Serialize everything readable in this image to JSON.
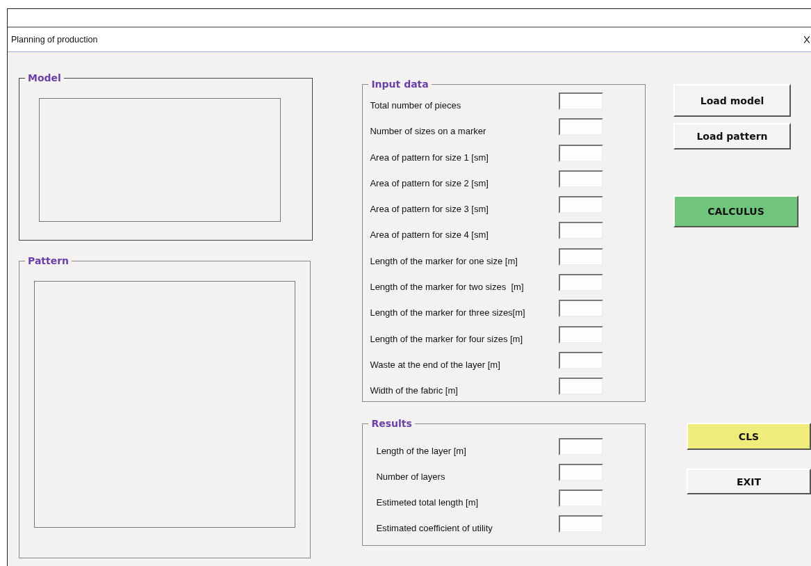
{
  "window": {
    "title": "Planning of production"
  },
  "model": {
    "legend": "Model"
  },
  "pattern": {
    "legend": "Pattern"
  },
  "input_data": {
    "legend": "Input data",
    "fields": [
      {
        "label": "Total number of pieces"
      },
      {
        "label": "Number of sizes on a marker"
      },
      {
        "label": "Area of pattern for size 1 [sm]"
      },
      {
        "label": "Area of pattern for size 2 [sm]"
      },
      {
        "label": "Area of pattern for size 3 [sm]"
      },
      {
        "label": "Area of pattern for size 4 [sm]"
      },
      {
        "label": "Length of the marker for one size [m]"
      },
      {
        "label": "Length of the marker for two sizes  [m]"
      },
      {
        "label": "Length of the marker for three sizes[m]"
      },
      {
        "label": "Length of the marker for four sizes [m]"
      },
      {
        "label": "Waste at the end of the layer [m]"
      },
      {
        "label": "Width of the fabric [m]"
      }
    ]
  },
  "results": {
    "legend": "Results",
    "fields": [
      {
        "label": "Length of the layer [m]"
      },
      {
        "label": "Number of layers"
      },
      {
        "label": "Estimeted total length [m]"
      },
      {
        "label": "Estimated coefficient of utility"
      }
    ]
  },
  "buttons": [
    {
      "label": "Load model",
      "kind": "plain"
    },
    {
      "label": "Load pattern",
      "kind": "plain"
    },
    {
      "label": "CALCULUS",
      "kind": "green"
    },
    {
      "label": "CLS",
      "kind": "yellow"
    },
    {
      "label": "EXIT",
      "kind": "plain"
    }
  ]
}
